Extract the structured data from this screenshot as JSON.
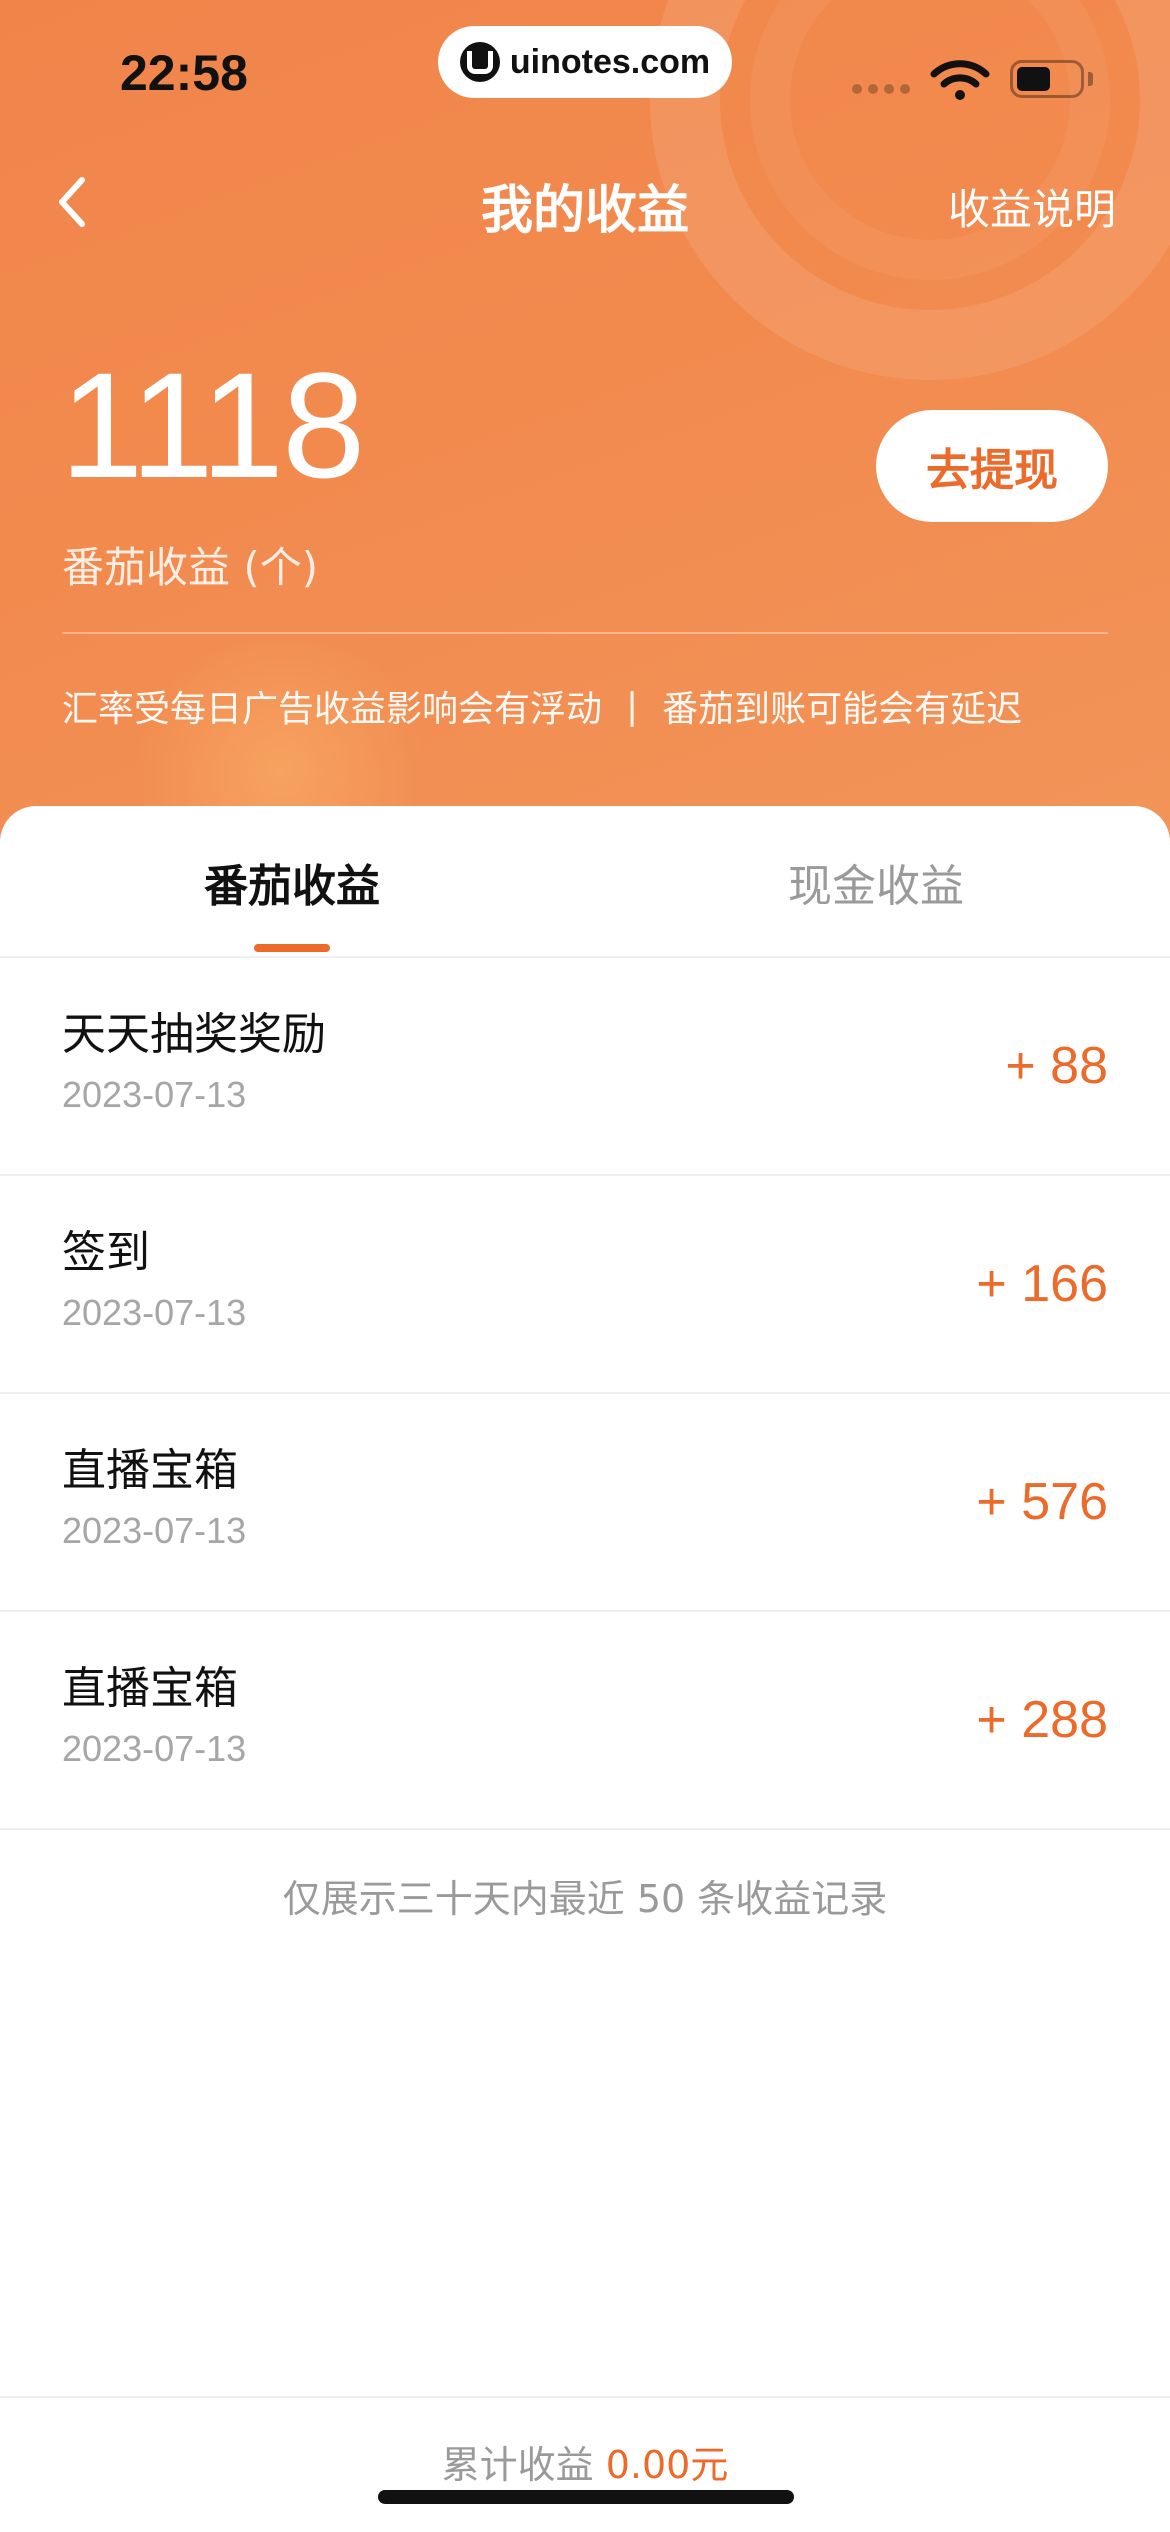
{
  "status_bar": {
    "time": "22:58",
    "url": "uinotes.com",
    "icons": [
      "cellular-signal-icon",
      "wifi-icon",
      "battery-icon"
    ]
  },
  "nav": {
    "back_icon": "chevron-left-icon",
    "title": "我的收益",
    "help_link": "收益说明"
  },
  "balance": {
    "value": "1118",
    "label": "番茄收益 (个)",
    "withdraw_label": "去提现"
  },
  "notice": {
    "left": "汇率受每日广告收益影响会有浮动",
    "separator": "|",
    "right": "番茄到账可能会有延迟"
  },
  "tabs": [
    {
      "label": "番茄收益",
      "active": true
    },
    {
      "label": "现金收益",
      "active": false
    }
  ],
  "records": [
    {
      "title": "天天抽奖奖励",
      "date": "2023-07-13",
      "amount": "+ 88"
    },
    {
      "title": "签到",
      "date": "2023-07-13",
      "amount": "+ 166"
    },
    {
      "title": "直播宝箱",
      "date": "2023-07-13",
      "amount": "+ 576"
    },
    {
      "title": "直播宝箱",
      "date": "2023-07-13",
      "amount": "+ 288"
    }
  ],
  "footnote": "仅展示三十天内最近 50 条收益记录",
  "total": {
    "label": "累计收益",
    "value": "0.00元"
  },
  "colors": {
    "accent": "#ec6a2a",
    "header_gradient_start": "#f0854a",
    "header_gradient_end": "#f29459"
  }
}
